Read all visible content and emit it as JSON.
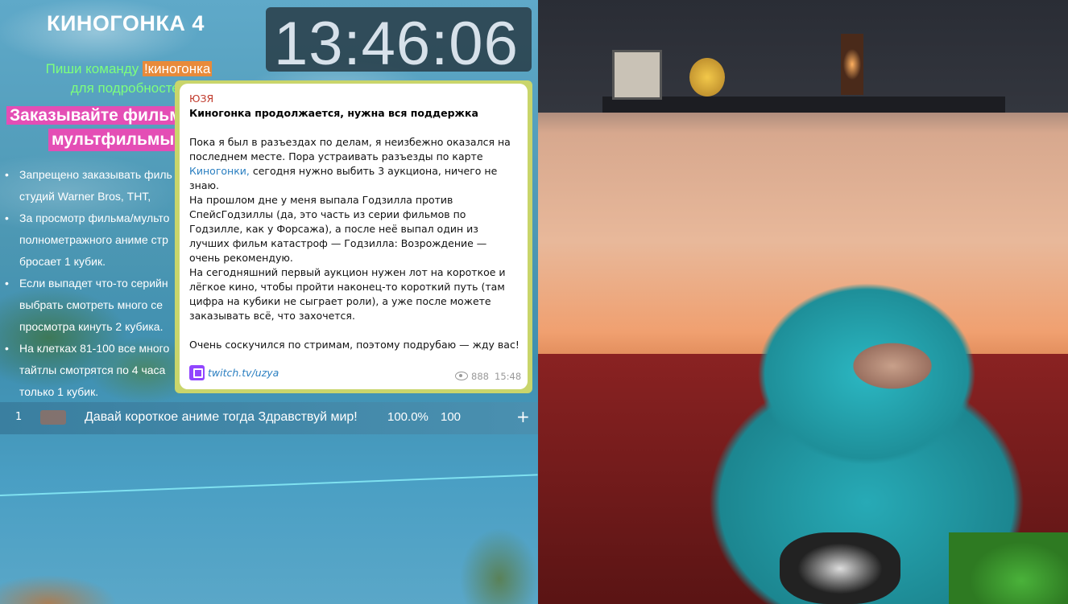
{
  "overlay": {
    "title": "КИНОГОНКА 4",
    "clock": "13:46:06",
    "command_prefix": "Пиши команду",
    "command_keyword": "!киногонка",
    "command_suffix": "для подробностей",
    "order_line1": "Заказывайте фильмы,",
    "order_line2": "мультфильмы, ан",
    "rules": [
      "Запрещено заказывать филь от студий Warner Bros, ТНТ,",
      "За просмотр фильма/мульто полнометражного аниме стр бросает 1 кубик.",
      "Если выпадет что-то серийн выбрать смотреть много се просмотра кинуть 2 кубика.",
      "На клетках 81-100 все много тайтлы смотрятся по 4 часа только 1 кубик."
    ]
  },
  "ticker": {
    "index": "1",
    "text": "Давай короткое аниме тогда Здравствуй мир!",
    "percent": "100.0%",
    "count": "100",
    "plus": "+"
  },
  "post": {
    "channel": "ЮЗЯ",
    "headline": "Киногонка продолжается, нужна вся поддержка",
    "p1_a": "Пока я был в разъездах по делам, я неизбежно оказался на последнем месте. Пора устраивать разъезды по карте",
    "p1_link": "Киногонки,",
    "p1_b": "сегодня нужно выбить 3 аукциона, ничего не знаю.",
    "p2": "На прошлом дне у меня выпала Годзилла против СпейсГодзиллы (да, это часть из серии фильмов по Годзилле, как у Форсажа), а после неё выпал один из лучших фильм катастроф — Годзилла: Возрождение — очень рекомендую.",
    "p3": "На сегодняшний первый аукцион нужен лот на короткое и лёгкое кино, чтобы пройти наконец-то короткий путь (там цифра на кубики не сыграет роли), а уже после можете заказывать всё, что захочется.",
    "p4": "Очень соскучился по стримам, поэтому подрубаю — жду вас!",
    "link": "twitch.tv/uzya",
    "views": "888",
    "time": "15:48"
  },
  "colors": {
    "channel": "#c0392b",
    "link": "#2a7fc1",
    "hoodie": "#27aab6",
    "command": "#7dff7d",
    "highlight": "#e44eb5"
  },
  "icons": [
    "twitch-icon",
    "eye-icon"
  ]
}
